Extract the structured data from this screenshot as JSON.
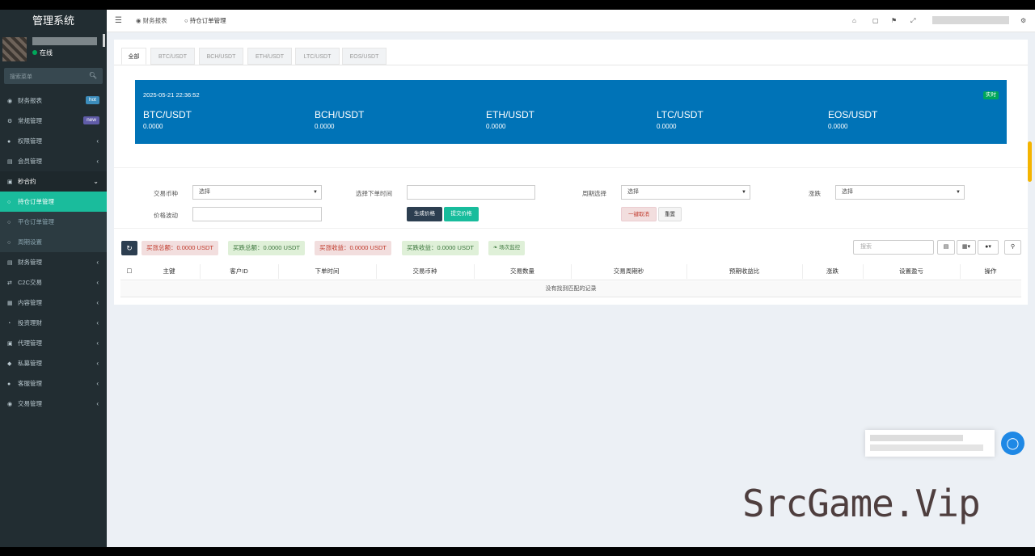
{
  "app": {
    "title": "管理系统"
  },
  "user": {
    "status": "在线"
  },
  "sidebar": {
    "search_placeholder": "搜索菜单",
    "items": [
      {
        "icon": "dashboard-icon",
        "label": "财务报表",
        "badge": "hot",
        "badge_color": "#3c8dbc"
      },
      {
        "icon": "gears-icon",
        "label": "常规管理",
        "badge": "new",
        "badge_color": "#605ca8"
      },
      {
        "icon": "users-icon",
        "label": "权限管理"
      },
      {
        "icon": "list-icon",
        "label": "会员管理"
      },
      {
        "icon": "calendar-icon",
        "label": "秒合约"
      },
      {
        "icon": "circle-icon",
        "label": "持仓订单管理"
      },
      {
        "icon": "circle-icon",
        "label": "平仓订单管理"
      },
      {
        "icon": "circle-icon",
        "label": "周期设置"
      },
      {
        "icon": "list-icon",
        "label": "财务管理"
      },
      {
        "icon": "exchange-icon",
        "label": "C2C交易"
      },
      {
        "icon": "file-icon",
        "label": "内容管理"
      },
      {
        "icon": "pie-icon",
        "label": "投资理财"
      },
      {
        "icon": "briefcase-icon",
        "label": "代理管理"
      },
      {
        "icon": "diamond-icon",
        "label": "私募管理"
      },
      {
        "icon": "comment-icon",
        "label": "客服管理"
      },
      {
        "icon": "eye-icon",
        "label": "交易管理"
      }
    ]
  },
  "topbar": {
    "tabs": [
      {
        "icon": "dashboard-icon",
        "label": "财务报表"
      },
      {
        "icon": "circle-icon",
        "label": "持仓订单管理"
      }
    ]
  },
  "content": {
    "tabs": [
      "全部",
      "BTC/USDT",
      "BCH/USDT",
      "ETH/USDT",
      "LTC/USDT",
      "EOS/USDT"
    ],
    "ticker": {
      "time": "2025-05-21 22:36:52",
      "badge": "实时",
      "pairs": [
        {
          "name": "BTC/USDT",
          "value": "0.0000"
        },
        {
          "name": "BCH/USDT",
          "value": "0.0000"
        },
        {
          "name": "ETH/USDT",
          "value": "0.0000"
        },
        {
          "name": "LTC/USDT",
          "value": "0.0000"
        },
        {
          "name": "EOS/USDT",
          "value": "0.0000"
        }
      ]
    },
    "form": {
      "coin_label": "交易币种",
      "coin_value": "选择",
      "time_label": "选择下单时间",
      "period_label": "周期选择",
      "period_value": "选择",
      "updown_label": "涨跌",
      "updown_value": "选择",
      "volatility_label": "价格波动",
      "generate_btn": "生成价格",
      "submit_btn": "提交价格",
      "cancel_btn": "一键取消",
      "reset_btn": "重置"
    },
    "stats": {
      "buy_up_total": "买涨总额：0.0000 USDT",
      "buy_down_total": "买跌总额：0.0000 USDT",
      "buy_up_profit": "买涨收益：0.0000 USDT",
      "buy_down_profit": "买跌收益：0.0000 USDT",
      "monitor": "场次监控"
    },
    "search_placeholder": "搜索",
    "table": {
      "columns": [
        "主键",
        "客户ID",
        "下单时间",
        "交易币种",
        "交易数量",
        "交易周期秒",
        "预期收益比",
        "涨跌",
        "设置盈亏",
        "操作"
      ],
      "empty_text": "没有找到匹配的记录"
    }
  },
  "watermark": "SrcGame.Vip",
  "colors": {
    "sidebar": "#222d32",
    "accent": "#1abc9c",
    "ticker": "#0073b7",
    "dark_btn": "#2c3e50"
  }
}
